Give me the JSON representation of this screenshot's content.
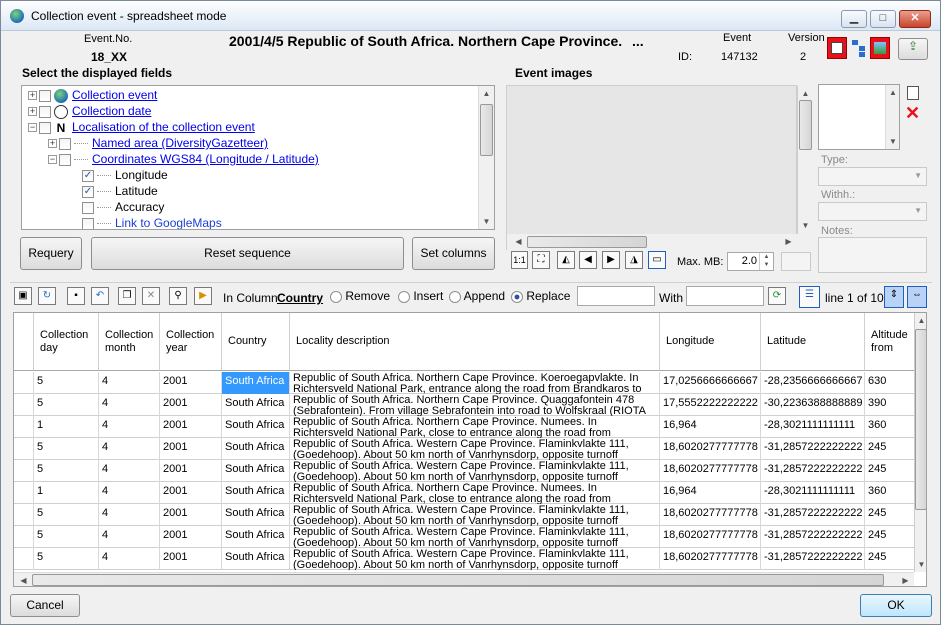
{
  "window": {
    "title": "Collection event - spreadsheet mode"
  },
  "header": {
    "event_no_label": "Event.No.",
    "event_no_value": "18_XX",
    "title": "2001/4/5 Republic of South Africa. Northern Cape Province.",
    "title_ellipsis": "...",
    "event_label": "Event",
    "id_label": "ID:",
    "id_value": "147132",
    "version_label": "Version",
    "version_value": "2"
  },
  "fields_panel": {
    "title": "Select the displayed fields",
    "items": [
      {
        "label": "Collection event",
        "checked": false,
        "expander": "+"
      },
      {
        "label": "Collection date",
        "checked": false,
        "expander": "+"
      },
      {
        "label": "Localisation of the collection event",
        "checked": false,
        "expander": "−"
      },
      {
        "label": "Named area (DiversityGazetteer)",
        "checked": false,
        "expander": "+"
      },
      {
        "label": "Coordinates WGS84 (Longitude / Latitude)",
        "checked": false,
        "expander": "−"
      },
      {
        "label": "Longitude",
        "checked": true
      },
      {
        "label": "Latitude",
        "checked": true
      },
      {
        "label": "Accuracy",
        "checked": false
      },
      {
        "label": "Link to GoogleMaps",
        "checked": false
      }
    ],
    "checkmark": "✓",
    "requery_label": "Requery",
    "reset_label": "Reset sequence",
    "set_columns_label": "Set columns"
  },
  "images_panel": {
    "title": "Event images",
    "type_label": "Type:",
    "withh_label": "Withh.:",
    "notes_label": "Notes:",
    "max_mb_label": "Max. MB:",
    "max_mb_value": "2.0",
    "zoom_label": "1:1"
  },
  "toolbar": {
    "in_column_label": "In Column",
    "column_name": "Country",
    "remove_label": "Remove",
    "insert_label": "Insert",
    "append_label": "Append",
    "replace_label": "Replace",
    "with_label": "With",
    "line_info": "line 1 of 10",
    "selected_mode": "Replace"
  },
  "grid": {
    "columns": [
      "Collection day",
      "Collection month",
      "Collection year",
      "Country",
      "Locality description",
      "Longitude",
      "Latitude",
      "Altitude from"
    ],
    "rows": [
      [
        "5",
        "4",
        "2001",
        "South Africa",
        "Republic of South Africa. Northern Cape Province. Koeroegapvlakte. In Richtersveld National Park, entrance along the road from Brandkaros to",
        "17,0256666666667",
        "-28,2356666666667",
        "630"
      ],
      [
        "5",
        "4",
        "2001",
        "South Africa",
        "Republic of South Africa. Northern Cape Province. Quaggafontein 478 (Sebrafontein). From village Sebrafontein into road to Wolfskraal (RIOTA",
        "17,5552222222222",
        "-30,2236388888889",
        "390"
      ],
      [
        "1",
        "4",
        "2001",
        "South Africa",
        "Republic of South Africa. Northern Cape Province. Numees. In Richtersveld National Park, close to entrance along the road from Brandkaros to",
        "16,964",
        "-28,3021111111111",
        "360"
      ],
      [
        "5",
        "4",
        "2001",
        "South Africa",
        "Republic of South Africa. Western Cape Province. Flaminkvlakte 111, (Goedehoop). About 50 km north of Vanrhynsdorp, opposite turnoff",
        "18,6020277777778",
        "-31,2857222222222",
        "245"
      ],
      [
        "5",
        "4",
        "2001",
        "South Africa",
        "Republic of South Africa. Western Cape Province. Flaminkvlakte 111, (Goedehoop). About 50 km north of Vanrhynsdorp, opposite turnoff",
        "18,6020277777778",
        "-31,2857222222222",
        "245"
      ],
      [
        "1",
        "4",
        "2001",
        "South Africa",
        "Republic of South Africa. Northern Cape Province. Numees. In Richtersveld National Park, close to entrance along the road from Brandkaros to",
        "16,964",
        "-28,3021111111111",
        "360"
      ],
      [
        "5",
        "4",
        "2001",
        "South Africa",
        "Republic of South Africa. Western Cape Province. Flaminkvlakte 111, (Goedehoop). About 50 km north of Vanrhynsdorp, opposite turnoff",
        "18,6020277777778",
        "-31,2857222222222",
        "245"
      ],
      [
        "5",
        "4",
        "2001",
        "South Africa",
        "Republic of South Africa. Western Cape Province. Flaminkvlakte 111, (Goedehoop). About 50 km north of Vanrhynsdorp, opposite turnoff",
        "18,6020277777778",
        "-31,2857222222222",
        "245"
      ],
      [
        "5",
        "4",
        "2001",
        "South Africa",
        "Republic of South Africa. Western Cape Province. Flaminkvlakte 111, (Goedehoop). About 50 km north of Vanrhynsdorp, opposite turnoff",
        "18,6020277777778",
        "-31,2857222222222",
        "245"
      ]
    ]
  },
  "footer": {
    "cancel_label": "Cancel",
    "ok_label": "OK"
  },
  "colors": {
    "accent_red": "#e8101b",
    "selection_blue": "#3399ff",
    "link_blue": "#0000ee"
  }
}
